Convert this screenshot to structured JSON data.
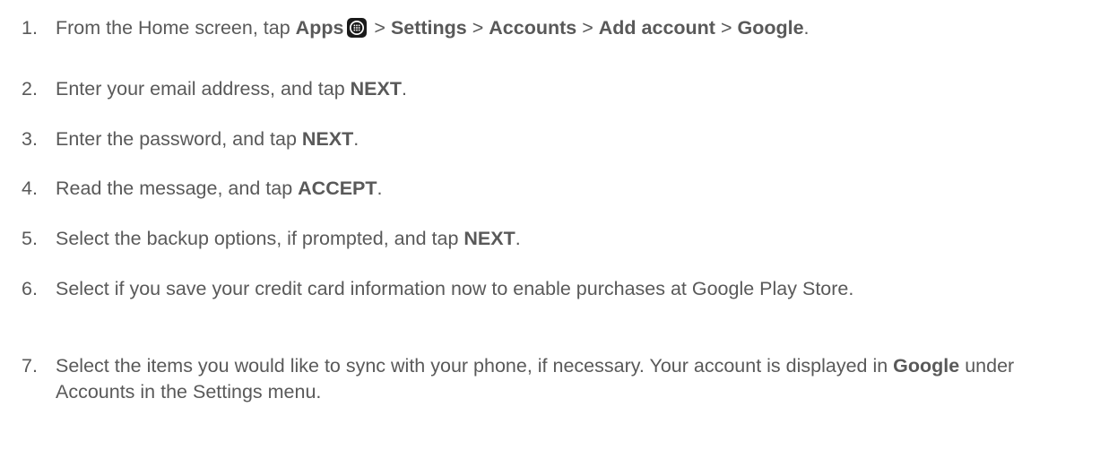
{
  "steps": [
    {
      "number": "1.",
      "t1": "From the Home screen, tap ",
      "b1": "Apps",
      "t2": " > ",
      "b2": "Settings",
      "t3": " > ",
      "b3": "Accounts",
      "t4": " > ",
      "b4": "Add account",
      "t5": " > ",
      "b5": "Google",
      "t6": ".",
      "icon": "apps-grid-icon"
    },
    {
      "number": "2.",
      "t1": "Enter your email address, and tap ",
      "b1": "NEXT",
      "t2": "."
    },
    {
      "number": "3.",
      "t1": "Enter the password, and tap ",
      "b1": "NEXT",
      "t2": "."
    },
    {
      "number": "4.",
      "t1": "Read the message, and tap ",
      "b1": "ACCEPT",
      "t2": "."
    },
    {
      "number": "5.",
      "t1": "Select the backup options, if prompted, and tap ",
      "b1": "NEXT",
      "t2": "."
    },
    {
      "number": "6.",
      "t1": "Select if you save your credit card information now to enable purchases at Google Play Store."
    },
    {
      "number": "7.",
      "t1": "Select the items you would like to sync with your phone, if necessary. Your account is displayed in ",
      "b1": "Google",
      "t2": " under Accounts in the Settings menu."
    }
  ]
}
